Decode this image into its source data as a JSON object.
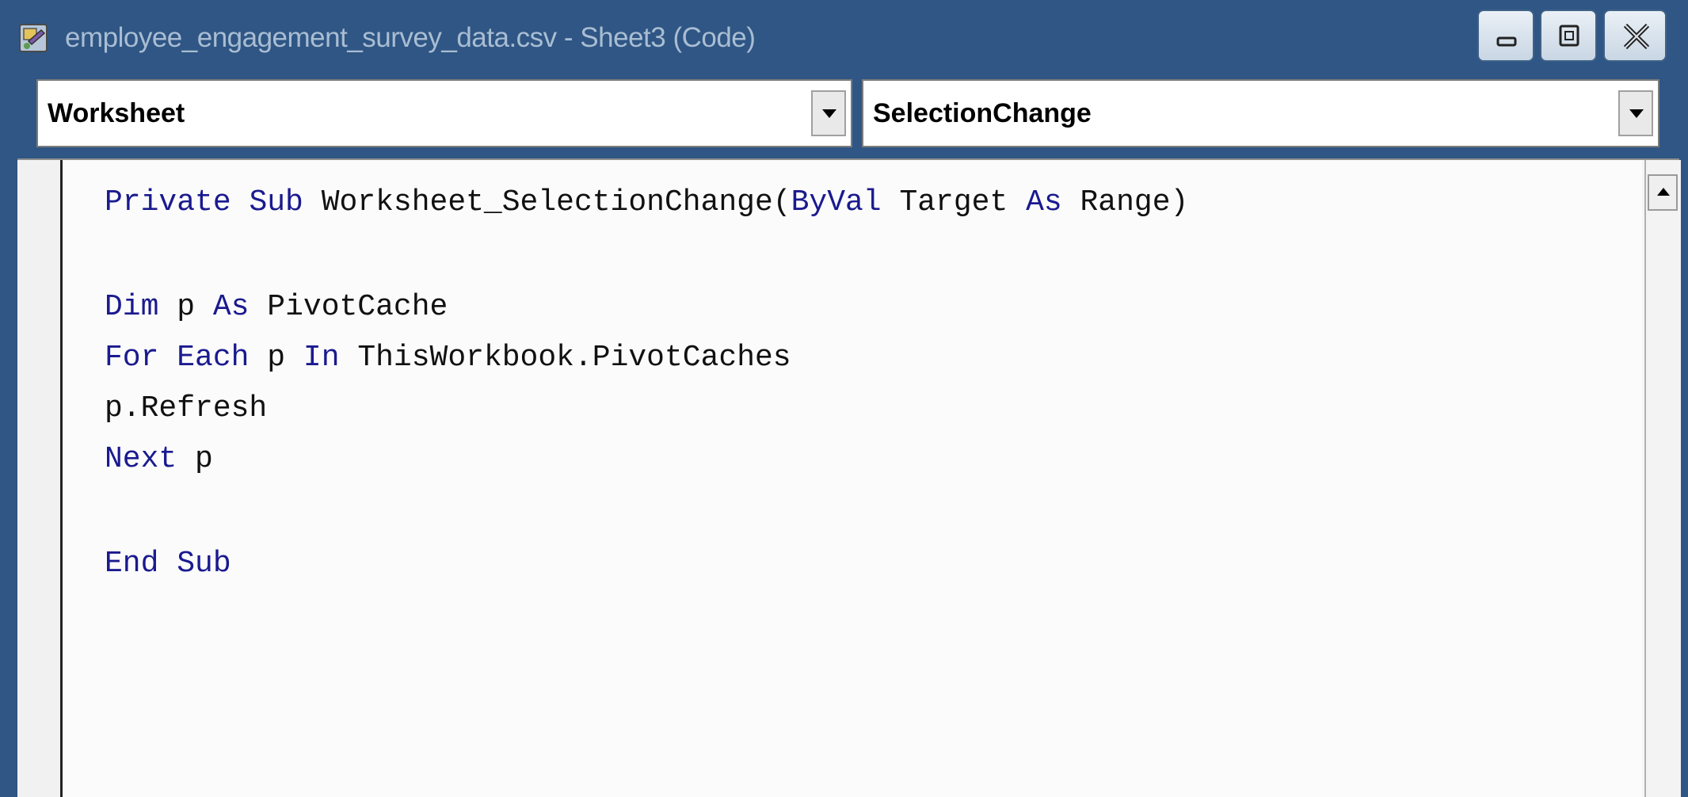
{
  "window": {
    "title": "employee_engagement_survey_data.csv - Sheet3 (Code)",
    "icon": "vba-module-icon",
    "controls": [
      "minimize-icon",
      "maximize-icon",
      "close-icon"
    ]
  },
  "object_dropdown": {
    "value": "Worksheet"
  },
  "procedure_dropdown": {
    "value": "SelectionChange"
  },
  "code": {
    "line1": {
      "k1": "Private",
      "k2": "Sub",
      "t1": "Worksheet_SelectionChange(",
      "k3": "ByVal",
      "t2": "Target",
      "k4": "As",
      "t3": "Range)"
    },
    "line2": {
      "k1": "Dim",
      "t1": "p",
      "k2": "As",
      "t2": "PivotCache"
    },
    "line3": {
      "k1": "For",
      "k2": "Each",
      "t1": "p",
      "k3": "In",
      "t2": "ThisWorkbook.PivotCaches"
    },
    "line4": {
      "t1": "p.Refresh"
    },
    "line5": {
      "k1": "Next",
      "t1": "p"
    },
    "line6": {
      "k1": "End",
      "k2": "Sub"
    }
  },
  "colors": {
    "keyword": "#1a1a8f",
    "text": "#111111",
    "frame": "#2f5684"
  }
}
